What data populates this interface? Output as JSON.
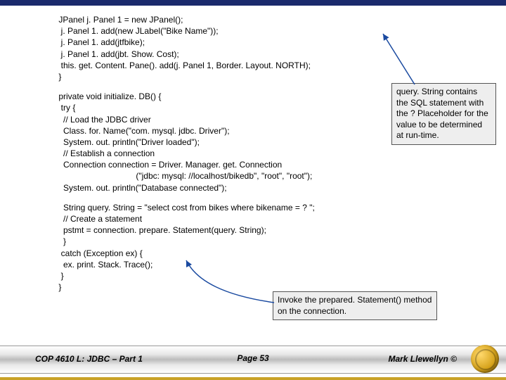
{
  "code": {
    "block1": " JPanel j. Panel 1 = new JPanel();\n  j. Panel 1. add(new JLabel(\"Bike Name\"));\n  j. Panel 1. add(jtfbike);\n  j. Panel 1. add(jbt. Show. Cost);\n  this. get. Content. Pane(). add(j. Panel 1, Border. Layout. NORTH);\n }",
    "block2": " private void initialize. DB() {\n  try {\n   // Load the JDBC driver\n   Class. for. Name(\"com. mysql. jdbc. Driver\");\n   System. out. println(\"Driver loaded\");\n   // Establish a connection\n   Connection connection = Driver. Manager. get. Connection\n                                  (\"jdbc: mysql: //localhost/bikedb\", \"root\", \"root\");\n   System. out. println(\"Database connected\");",
    "block3": "   String query. String = \"select cost from bikes where bikename = ? \";\n   // Create a statement\n   pstmt = connection. prepare. Statement(query. String);\n   }\n  catch (Exception ex) {\n   ex. print. Stack. Trace();\n  }\n }"
  },
  "callouts": {
    "queryString": "query. String contains the SQL statement with the ? Placeholder for the value to be determined at run-time.",
    "preparedStatement": "Invoke the prepared. Statement() method on the connection."
  },
  "footer": {
    "left": "COP 4610 L: JDBC – Part 1",
    "center": "Page 53",
    "right": "Mark Llewellyn ©"
  }
}
